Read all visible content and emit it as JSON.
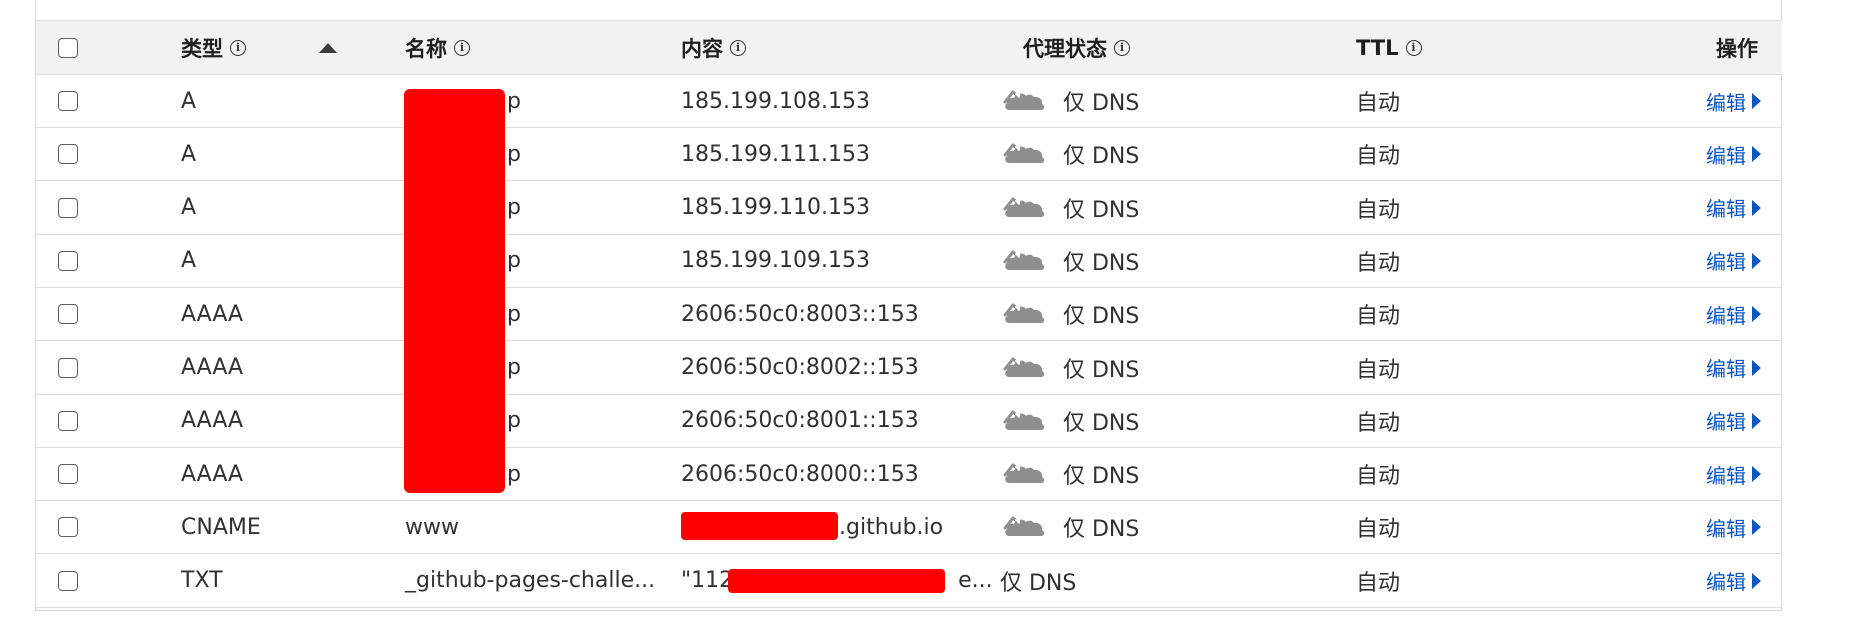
{
  "header": {
    "type_label": "类型",
    "name_label": "名称",
    "content_label": "内容",
    "proxy_label": "代理状态",
    "ttl_label": "TTL",
    "actions_label": "操作"
  },
  "rows": [
    {
      "type": "A",
      "name": "p",
      "content": "185.199.108.153",
      "proxy": "仅 DNS",
      "ttl": "自动",
      "action": "编辑"
    },
    {
      "type": "A",
      "name": "p",
      "content": "185.199.111.153",
      "proxy": "仅 DNS",
      "ttl": "自动",
      "action": "编辑"
    },
    {
      "type": "A",
      "name": "p",
      "content": "185.199.110.153",
      "proxy": "仅 DNS",
      "ttl": "自动",
      "action": "编辑"
    },
    {
      "type": "A",
      "name": "p",
      "content": "185.199.109.153",
      "proxy": "仅 DNS",
      "ttl": "自动",
      "action": "编辑"
    },
    {
      "type": "AAAA",
      "name": "p",
      "content": "2606:50c0:8003::153",
      "proxy": "仅 DNS",
      "ttl": "自动",
      "action": "编辑"
    },
    {
      "type": "AAAA",
      "name": "p",
      "content": "2606:50c0:8002::153",
      "proxy": "仅 DNS",
      "ttl": "自动",
      "action": "编辑"
    },
    {
      "type": "AAAA",
      "name": "p",
      "content": "2606:50c0:8001::153",
      "proxy": "仅 DNS",
      "ttl": "自动",
      "action": "编辑"
    },
    {
      "type": "AAAA",
      "name": "p",
      "content": "2606:50c0:8000::153",
      "proxy": "仅 DNS",
      "ttl": "自动",
      "action": "编辑"
    },
    {
      "type": "CNAME",
      "name": "www",
      "content": ".github.io",
      "proxy": "仅 DNS",
      "ttl": "自动",
      "action": "编辑"
    },
    {
      "type": "TXT",
      "name": "_github-pages-challe...",
      "content_prefix": "\"112",
      "content_suffix": "e...",
      "proxy": "仅 DNS",
      "ttl": "自动",
      "action": "编辑"
    }
  ],
  "icons": {
    "info": "info-icon",
    "sort": "sort-ascending-icon",
    "cloud": "dns-only-cloud-icon",
    "caret": "caret-right-icon"
  },
  "colors": {
    "link": "#0a55c4",
    "redaction": "#ff0000",
    "header_bg": "#f2f2f2",
    "cloud": "#8f8f8f"
  }
}
